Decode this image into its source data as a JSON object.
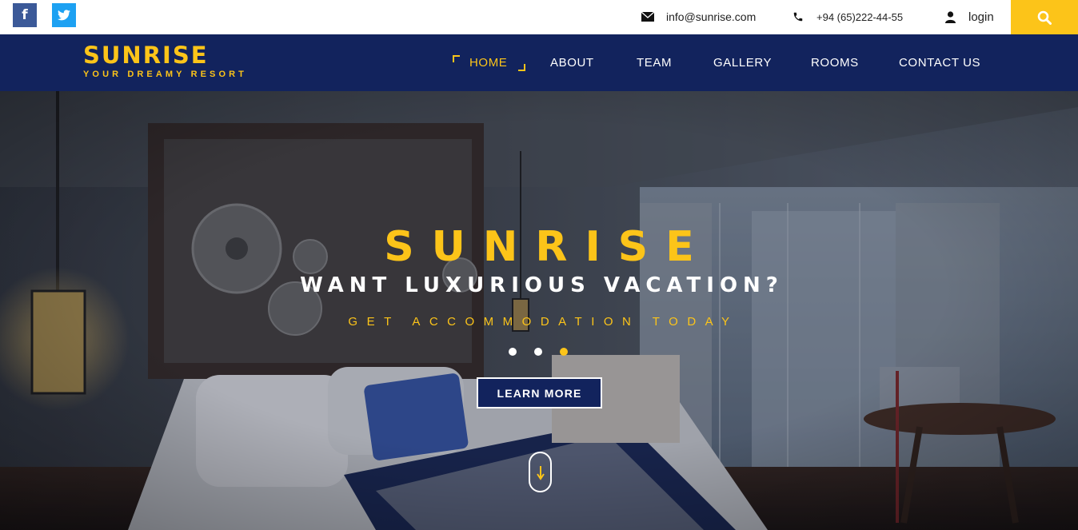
{
  "topbar": {
    "social": [
      {
        "icon": "facebook-icon",
        "label": "f"
      },
      {
        "icon": "twitter-icon"
      }
    ],
    "email": "info@sunrise.com",
    "phone": "+94 (65)222-44-55",
    "login": "login",
    "search_icon": "search-icon"
  },
  "brand": {
    "name": "SUNRISE",
    "tagline": "YOUR DREAMY RESORT"
  },
  "nav": {
    "items": [
      {
        "label": "HOME",
        "active": true
      },
      {
        "label": "ABOUT"
      },
      {
        "label": "TEAM"
      },
      {
        "label": "GALLERY"
      },
      {
        "label": "ROOMS"
      },
      {
        "label": "CONTACT US"
      }
    ]
  },
  "hero": {
    "title": "SUNRISE",
    "subtitle": "WANT LUXURIOUS VACATION?",
    "tagline": "GET ACCOMMODATION TODAY",
    "slide_count": 3,
    "active_slide": 3,
    "button_label": "LEARN MORE",
    "scroll_icon": "arrow-down-icon"
  },
  "colors": {
    "accent": "#fcc419",
    "navy": "#12235d",
    "facebook": "#3b5998",
    "twitter": "#1da1f2"
  }
}
